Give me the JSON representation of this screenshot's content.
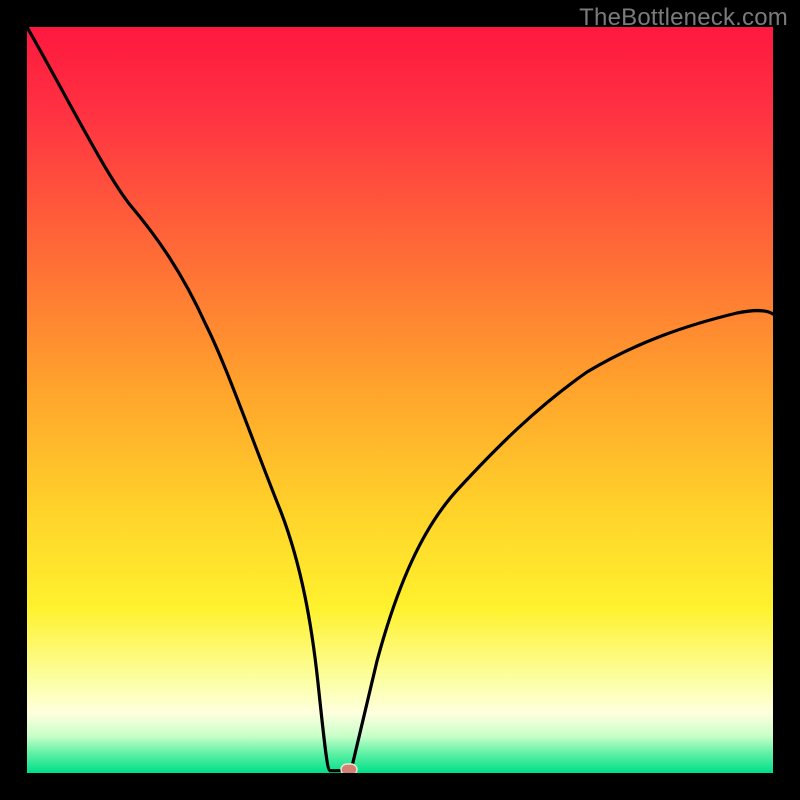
{
  "watermark": {
    "text": "TheBottleneck.com"
  },
  "colors": {
    "black": "#000000",
    "gradient_top": "#ff1a3a",
    "gradient_mid_orange": "#ff8a2a",
    "gradient_yellow": "#ffe92e",
    "gradient_pale": "#feffcf",
    "gradient_green": "#00e28a",
    "curve": "#000000",
    "marker_fill": "#d38272",
    "marker_stroke": "#eadfd8"
  },
  "chart_data": {
    "type": "line",
    "title": "",
    "xlabel": "",
    "ylabel": "",
    "xlim": [
      0,
      100
    ],
    "ylim": [
      0,
      100
    ],
    "background": "gradient red→orange→yellow→green (top→bottom)",
    "series": [
      {
        "name": "bottleneck-curve",
        "x": [
          0,
          8,
          14,
          20,
          24,
          28,
          32,
          36,
          39,
          40.6,
          43.4,
          44,
          47,
          50,
          54,
          58,
          62,
          67,
          72,
          78,
          85,
          92,
          100
        ],
        "y": [
          100,
          86,
          76,
          65,
          57,
          48,
          38,
          26,
          12,
          0.3,
          0.3,
          3,
          15,
          24,
          32,
          39,
          45,
          49.5,
          53,
          56,
          58.5,
          60,
          61.5
        ]
      }
    ],
    "plateau": {
      "x_start": 40.6,
      "x_end": 43.4,
      "y": 0.3
    },
    "marker": {
      "name": "optimal-point",
      "x": 43.2,
      "y": 0.3,
      "shape": "pill"
    }
  }
}
